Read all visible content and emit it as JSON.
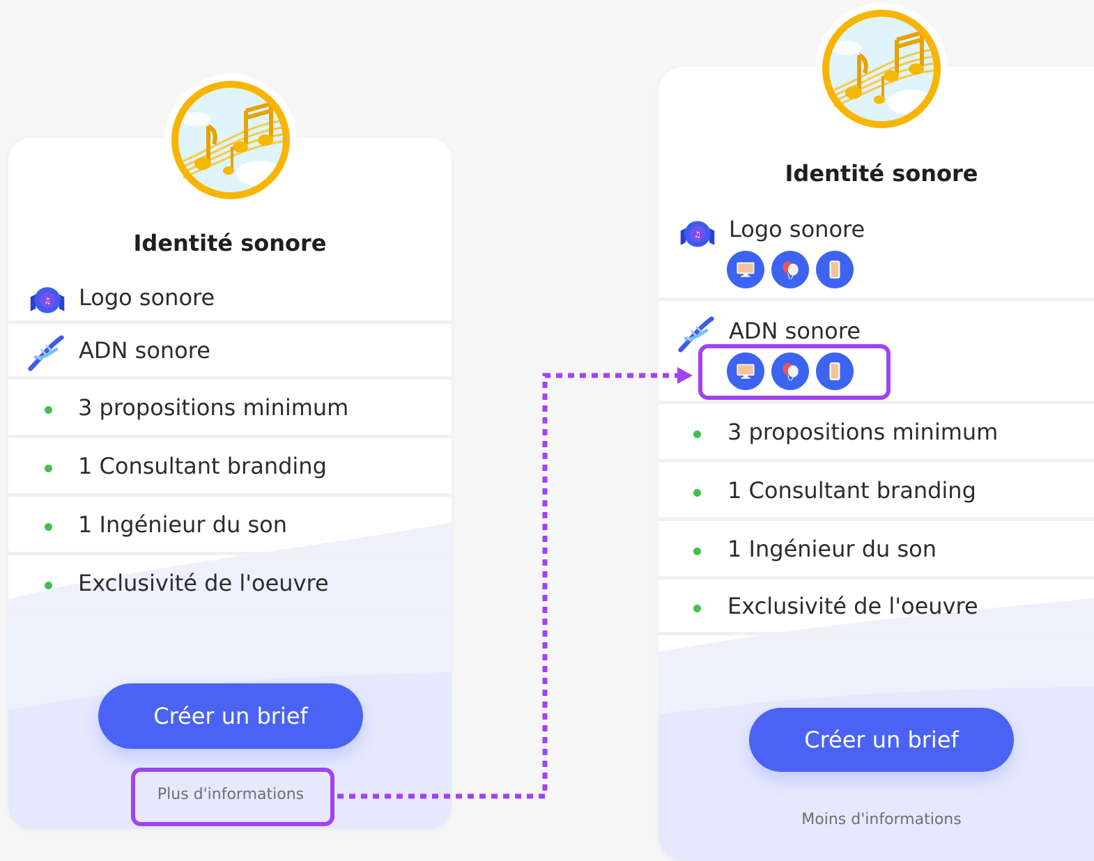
{
  "colors": {
    "accent": "#4a63f5",
    "bullet": "#43c04a",
    "highlight": "#a142f4",
    "title": "#1f1f1f",
    "gold": "#f5b800"
  },
  "collapsed_card": {
    "medallion_icon": "music-notes-medallion-icon",
    "title": "Identité sonore",
    "items": [
      {
        "icon": "sound-logo-badge-icon",
        "label": "Logo sonore"
      },
      {
        "icon": "dna-icon",
        "label": "ADN sonore"
      }
    ],
    "features": [
      "3 propositions minimum",
      "1 Consultant branding",
      "1 Ingénieur du son",
      "Exclusivité de l'oeuvre"
    ],
    "cta_label": "Créer un brief",
    "toggle_label": "Plus d'informations"
  },
  "expanded_card": {
    "medallion_icon": "music-notes-medallion-icon",
    "title": "Identité sonore",
    "items": [
      {
        "icon": "sound-logo-badge-icon",
        "label": "Logo sonore",
        "channels": [
          "desktop-monitor-icon",
          "balloons-icon",
          "smartphone-icon"
        ]
      },
      {
        "icon": "dna-icon",
        "label": "ADN sonore",
        "channels": [
          "desktop-monitor-icon",
          "balloons-icon",
          "smartphone-icon"
        ]
      }
    ],
    "features": [
      "3 propositions minimum",
      "1 Consultant branding",
      "1 Ingénieur du son",
      "Exclusivité de l'oeuvre"
    ],
    "cta_label": "Créer un brief",
    "toggle_label": "Moins d'informations"
  },
  "annotation": {
    "connector_icon": "dotted-arrow-icon"
  }
}
